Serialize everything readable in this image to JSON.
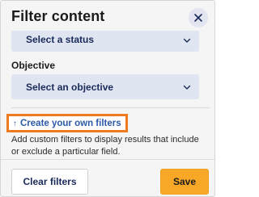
{
  "panel": {
    "title": "Filter content"
  },
  "filters": {
    "status": {
      "selected": "Select a status"
    },
    "objective": {
      "label": "Objective",
      "selected": "Select an objective"
    }
  },
  "custom_filters": {
    "link_label": "Create your own filters",
    "help_text": "Add custom filters to display results that include or exclude a particular field."
  },
  "footer": {
    "clear_label": "Clear filters",
    "save_label": "Save"
  },
  "colors": {
    "accent": "#f7a826",
    "highlight_border": "#f07b1e",
    "select_bg": "#e0e5f2",
    "link": "#2b5aa8"
  },
  "icons": {
    "close": "close-icon",
    "chevron": "chevron-down-icon",
    "arrow": "arrow-icon"
  }
}
